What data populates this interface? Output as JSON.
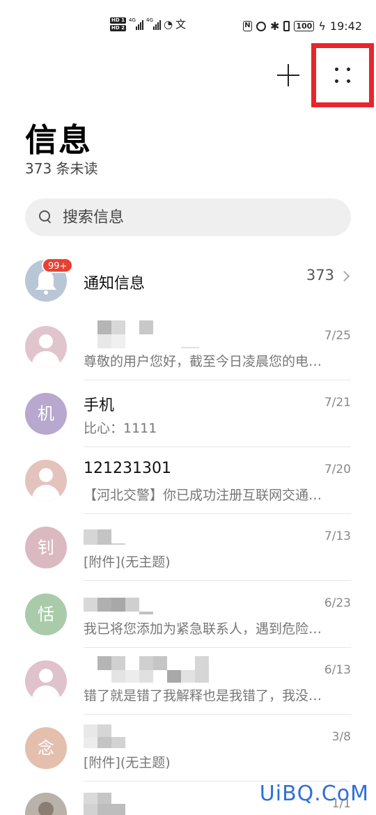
{
  "status_bar": {
    "hd1": "HD 1",
    "hd2": "HD 2",
    "net1": "4G",
    "net2": "4G",
    "battery": "100",
    "time": "19:42"
  },
  "header": {
    "title": "信息",
    "unread": "373 条未读"
  },
  "search": {
    "placeholder": "搜索信息"
  },
  "notification": {
    "name": "通知信息",
    "badge": "99+",
    "count": "373"
  },
  "conversations": [
    {
      "avatar": "",
      "avatar_color": "#e0c6cc",
      "name": "",
      "preview": "尊敬的用户您好，截至今日凌晨您的电…",
      "date": "7/25"
    },
    {
      "avatar": "机",
      "avatar_color": "#b8a7cf",
      "name": "手机",
      "preview": "比心：1111",
      "date": "7/21"
    },
    {
      "avatar": "",
      "avatar_color": "#e3c3bb",
      "name": "121231301",
      "preview": "【河北交警】你已成功注册互联网交通…",
      "date": "7/20"
    },
    {
      "avatar": "钊",
      "avatar_color": "#dbb9c0",
      "name": "",
      "preview": "[附件](无主题)",
      "date": "7/13"
    },
    {
      "avatar": "恬",
      "avatar_color": "#a9cba9",
      "name": "",
      "preview": "我已将您添加为紧急联系人，遇到危险…",
      "date": "6/23"
    },
    {
      "avatar": "",
      "avatar_color": "#dfc2cc",
      "name": "",
      "preview": "错了就是错了我解释也是我错了，我没…",
      "date": "6/13"
    },
    {
      "avatar": "念",
      "avatar_color": "#e4bfae",
      "name": "",
      "preview": "[附件](无主题)",
      "date": "3/8"
    },
    {
      "avatar": "",
      "avatar_color": "#c9c4c0",
      "name": "",
      "preview": "",
      "date": "1/1"
    }
  ],
  "watermark": "UiBQ.CoM"
}
